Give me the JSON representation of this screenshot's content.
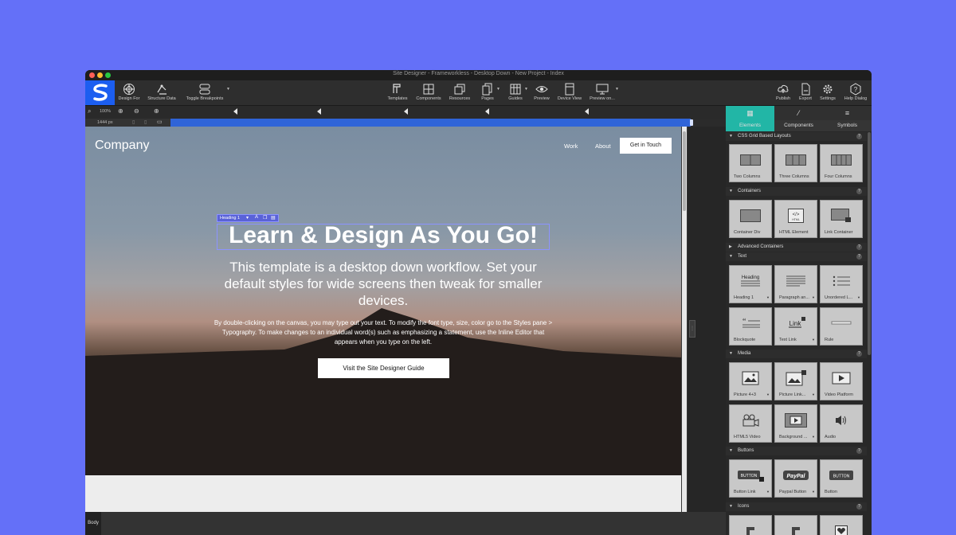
{
  "window": {
    "title": "Site Designer - Frameworkless - Desktop Down - New Project - Index"
  },
  "colors": {
    "accent": "#1c5ef0",
    "panel_tab_active": "#22b6a6",
    "selection": "#5a62d8",
    "background": "#6470f8"
  },
  "toolbar": {
    "design_for": "Design For",
    "structure_data": "Structure Data",
    "toggle_breakpoints": "Toggle Breakpoints",
    "templates": "Templates",
    "components": "Components",
    "resources": "Resources",
    "pages": "Pages",
    "guides": "Guides",
    "preview": "Preview",
    "device_view": "Device View",
    "preview_on": "Preview on...",
    "publish": "Publish",
    "export": "Export",
    "settings": "Settings",
    "help_dialog": "Help Dialog"
  },
  "ruler": {
    "zoom": "100%",
    "width": "1444 px"
  },
  "site": {
    "brand": "Company",
    "nav": [
      "Work",
      "About"
    ],
    "cta": "Get in Touch",
    "selection_label": "Heading 1",
    "heading": "Learn & Design As You Go!",
    "subheading": "This template is a desktop down workflow. Set your default styles for wide screens then tweak for smaller devices.",
    "body": "By double-clicking on the canvas, you may type out your text. To modify the font type, size, color go to the Styles pane > Typography. To make changes to an individual word(s) such as emphasizing a statement, use the Inline Editor that appears when you type on the left.",
    "button": "Visit the Site Designer Guide"
  },
  "status": {
    "breadcrumb": "Body"
  },
  "panel": {
    "tabs": [
      "Elements",
      "Components",
      "Symbols"
    ],
    "sections": {
      "grid": "CSS Grid Based Layouts",
      "containers": "Containers",
      "advanced": "Advanced Containers",
      "text": "Text",
      "media": "Media",
      "buttons": "Buttons",
      "icons": "Icons"
    },
    "grid_items": [
      "Two Columns",
      "Three Columns",
      "Four Columns"
    ],
    "container_items": [
      "Container Div",
      "HTML Element",
      "Link Container"
    ],
    "text_items": [
      "Heading 1",
      "Paragraph an...",
      "Unordered L...",
      "Blockquote",
      "Text Link",
      "Rule"
    ],
    "text_icons": {
      "heading": "Heading",
      "link": "Link"
    },
    "media_items": [
      "Picture 4+3",
      "Picture Link...",
      "Video Platform",
      "HTML5 Video",
      "Background ...",
      "Audio"
    ],
    "button_items": [
      "Button Link",
      "Paypal Button",
      "Button"
    ],
    "button_icons": {
      "button": "BUTTON",
      "paypal": "PayPal"
    },
    "help": "?"
  }
}
